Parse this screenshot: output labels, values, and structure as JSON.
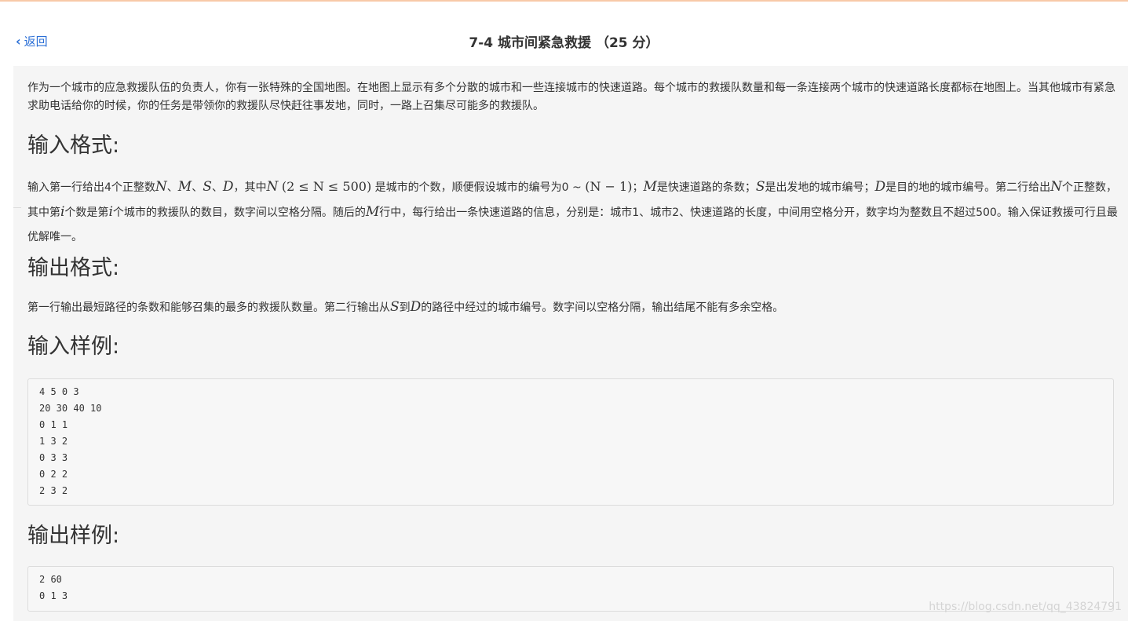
{
  "header": {
    "back_label": "返回",
    "title": "7-4 城市间紧急救援 （25 分）"
  },
  "description": "作为一个城市的应急救援队伍的负责人，你有一张特殊的全国地图。在地图上显示有多个分散的城市和一些连接城市的快速道路。每个城市的救援队数量和每一条连接两个城市的快速道路长度都标在地图上。当其他城市有紧急求助电话给你的时候，你的任务是带领你的救援队尽快赶往事发地，同时，一路上召集尽可能多的救援队。",
  "input_format": {
    "heading": "输入格式:",
    "t1": "输入第一行给出4个正整数",
    "v_N": "N",
    "sep1": "、",
    "v_M": "M",
    "sep2": "、",
    "v_S": "S",
    "sep3": "、",
    "v_D": "D",
    "t2": "，其中",
    "v_N2": "N",
    "range_math": "(2 ≤ N ≤ 500)",
    "t3": "是城市的个数，顺便假设城市的编号为0 ~",
    "range_math2": "(N − 1)",
    "t4": "；",
    "v_M2": "M",
    "t5": "是快速道路的条数；",
    "v_S2": "S",
    "t6": "是出发地的城市编号；",
    "v_D2": "D",
    "t7": "是目的地的城市编号。第二行给出",
    "v_N3": "N",
    "t8": "个正整数，其中第",
    "v_i1": "i",
    "t9": "个数是第",
    "v_i2": "i",
    "t10": "个城市的救援队的数目，数字间以空格分隔。随后的",
    "v_M3": "M",
    "t11": "行中，每行给出一条快速道路的信息，分别是：城市1、城市2、快速道路的长度，中间用空格分开，数字均为整数且不超过500。输入保证救援可行且最优解唯一。"
  },
  "output_format": {
    "heading": "输出格式:",
    "t1": "第一行输出最短路径的条数和能够召集的最多的救援队数量。第二行输出从",
    "v_S": "S",
    "t2": "到",
    "v_D": "D",
    "t3": "的路径中经过的城市编号。数字间以空格分隔，输出结尾不能有多余空格。"
  },
  "sample_input": {
    "heading": "输入样例:",
    "code": "4 5 0 3\n20 30 40 10\n0 1 1\n1 3 2\n0 3 3\n0 2 2\n2 3 2"
  },
  "sample_output": {
    "heading": "输出样例:",
    "code": "2 60\n0 1 3"
  },
  "watermark": "https://blog.csdn.net/qq_43824791",
  "colors": {
    "link": "#2b6fd6",
    "content_bg": "#f5f5f5",
    "top_accent": "#f8c9a8"
  }
}
